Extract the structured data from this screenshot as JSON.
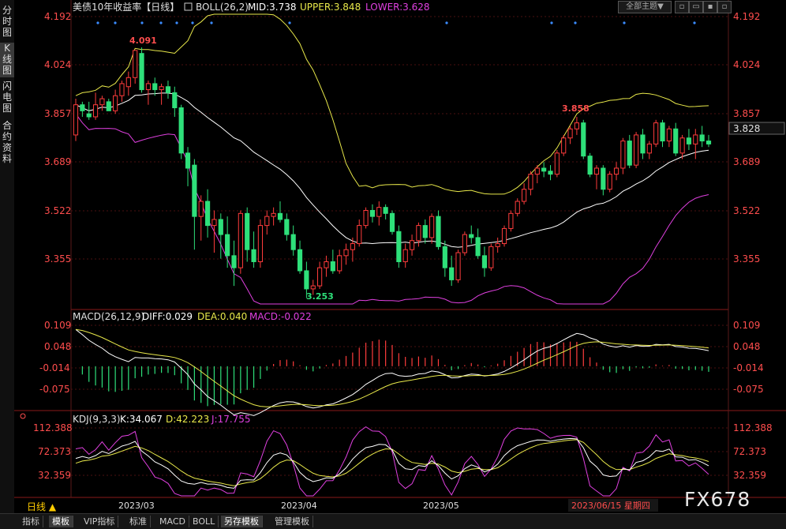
{
  "side_tabs": [
    "分时图",
    "K线图",
    "闪电图",
    "合约资料"
  ],
  "top_controls": {
    "theme": "全部主题▼"
  },
  "main_panel": {
    "title": "美债10年收益率【日线】",
    "boll_label": "BOLL(26,2)",
    "mid": "MID:3.738",
    "upper": "UPPER:3.848",
    "lower": "LOWER:3.628",
    "y_labels": [
      "4.192",
      "4.024",
      "3.857",
      "3.689",
      "3.522",
      "3.355"
    ],
    "current_price": "3.828",
    "high_mark": "4.091",
    "low_mark": "3.253",
    "recent_high_mark": "3.858"
  },
  "macd_panel": {
    "label": "MACD(26,12,9)",
    "diff": "DIFF:0.029",
    "dea": "DEA:0.040",
    "macd": "MACD:-0.022",
    "y_labels": [
      "0.109",
      "0.048",
      "-0.014",
      "-0.075"
    ]
  },
  "kdj_panel": {
    "label": "KDJ(9,3,3)",
    "k": "K:34.067",
    "d": "D:42.223",
    "j": "J:17.755",
    "y_labels": [
      "112.388",
      "72.373",
      "32.359"
    ]
  },
  "xaxis": {
    "period_label": "日线 ▲",
    "dates": [
      "2023/03",
      "2023/04",
      "2023/05"
    ],
    "cursor_date": "2023/06/15 星期四"
  },
  "bottom_tabs": [
    "指标",
    "模板",
    "VIP指标",
    "标准",
    "MACD",
    "BOLL",
    "另存模板",
    "管理模板"
  ],
  "brand": "FX678",
  "colors": {
    "up": "#ff3c3c",
    "down": "#2ee07a",
    "upper": "#e8e84a",
    "mid": "#ffffff",
    "lower": "#e040e0",
    "text": "#ff4d4d"
  },
  "chart_data": {
    "type": "candlestick",
    "title": "美债10年收益率【日线】",
    "ylim": [
      3.24,
      4.2
    ],
    "candles": [
      [
        3.8,
        3.92,
        3.78,
        3.9
      ],
      [
        3.9,
        3.91,
        3.86,
        3.88
      ],
      [
        3.87,
        3.91,
        3.85,
        3.86
      ],
      [
        3.86,
        3.94,
        3.85,
        3.9
      ],
      [
        3.9,
        3.93,
        3.88,
        3.92
      ],
      [
        3.91,
        3.92,
        3.88,
        3.88
      ],
      [
        3.88,
        3.95,
        3.87,
        3.93
      ],
      [
        3.93,
        3.98,
        3.91,
        3.97
      ],
      [
        3.96,
        4.01,
        3.93,
        3.99
      ],
      [
        3.99,
        4.08,
        3.97,
        4.08
      ],
      [
        4.07,
        4.09,
        3.94,
        3.95
      ],
      [
        3.95,
        3.98,
        3.9,
        3.97
      ],
      [
        3.97,
        3.99,
        3.93,
        3.95
      ],
      [
        3.95,
        3.97,
        3.9,
        3.96
      ],
      [
        3.96,
        3.98,
        3.92,
        3.94
      ],
      [
        3.94,
        3.96,
        3.86,
        3.89
      ],
      [
        3.89,
        3.9,
        3.72,
        3.74
      ],
      [
        3.74,
        3.76,
        3.63,
        3.69
      ],
      [
        3.7,
        3.72,
        3.42,
        3.53
      ],
      [
        3.53,
        3.6,
        3.45,
        3.58
      ],
      [
        3.58,
        3.62,
        3.46,
        3.5
      ],
      [
        3.5,
        3.55,
        3.41,
        3.52
      ],
      [
        3.52,
        3.54,
        3.39,
        3.47
      ],
      [
        3.47,
        3.53,
        3.36,
        3.4
      ],
      [
        3.4,
        3.45,
        3.3,
        3.36
      ],
      [
        3.36,
        3.55,
        3.34,
        3.54
      ],
      [
        3.54,
        3.56,
        3.38,
        3.42
      ],
      [
        3.42,
        3.48,
        3.36,
        3.38
      ],
      [
        3.38,
        3.52,
        3.36,
        3.5
      ],
      [
        3.5,
        3.55,
        3.47,
        3.53
      ],
      [
        3.53,
        3.56,
        3.5,
        3.54
      ],
      [
        3.54,
        3.58,
        3.51,
        3.52
      ],
      [
        3.52,
        3.54,
        3.45,
        3.47
      ],
      [
        3.47,
        3.5,
        3.4,
        3.42
      ],
      [
        3.42,
        3.45,
        3.34,
        3.35
      ],
      [
        3.35,
        3.38,
        3.26,
        3.29
      ],
      [
        3.29,
        3.32,
        3.27,
        3.3
      ],
      [
        3.3,
        3.38,
        3.29,
        3.36
      ],
      [
        3.36,
        3.4,
        3.33,
        3.38
      ],
      [
        3.38,
        3.42,
        3.34,
        3.35
      ],
      [
        3.35,
        3.42,
        3.34,
        3.4
      ],
      [
        3.4,
        3.44,
        3.37,
        3.42
      ],
      [
        3.42,
        3.46,
        3.38,
        3.44
      ],
      [
        3.44,
        3.52,
        3.43,
        3.5
      ],
      [
        3.5,
        3.56,
        3.49,
        3.55
      ],
      [
        3.55,
        3.57,
        3.51,
        3.53
      ],
      [
        3.53,
        3.58,
        3.5,
        3.56
      ],
      [
        3.56,
        3.57,
        3.52,
        3.54
      ],
      [
        3.54,
        3.55,
        3.47,
        3.48
      ],
      [
        3.48,
        3.5,
        3.36,
        3.38
      ],
      [
        3.38,
        3.44,
        3.36,
        3.42
      ],
      [
        3.42,
        3.47,
        3.4,
        3.45
      ],
      [
        3.45,
        3.51,
        3.43,
        3.5
      ],
      [
        3.5,
        3.52,
        3.44,
        3.46
      ],
      [
        3.46,
        3.54,
        3.44,
        3.53
      ],
      [
        3.53,
        3.55,
        3.42,
        3.43
      ],
      [
        3.43,
        3.45,
        3.33,
        3.36
      ],
      [
        3.36,
        3.4,
        3.3,
        3.32
      ],
      [
        3.32,
        3.42,
        3.31,
        3.41
      ],
      [
        3.41,
        3.48,
        3.4,
        3.47
      ],
      [
        3.47,
        3.5,
        3.44,
        3.46
      ],
      [
        3.46,
        3.49,
        3.39,
        3.4
      ],
      [
        3.4,
        3.43,
        3.33,
        3.36
      ],
      [
        3.36,
        3.44,
        3.35,
        3.43
      ],
      [
        3.43,
        3.46,
        3.41,
        3.44
      ],
      [
        3.44,
        3.5,
        3.43,
        3.49
      ],
      [
        3.49,
        3.55,
        3.48,
        3.54
      ],
      [
        3.54,
        3.59,
        3.53,
        3.58
      ],
      [
        3.58,
        3.64,
        3.57,
        3.62
      ],
      [
        3.62,
        3.68,
        3.6,
        3.67
      ],
      [
        3.67,
        3.7,
        3.64,
        3.69
      ],
      [
        3.69,
        3.71,
        3.66,
        3.68
      ],
      [
        3.68,
        3.7,
        3.65,
        3.67
      ],
      [
        3.67,
        3.75,
        3.66,
        3.74
      ],
      [
        3.74,
        3.8,
        3.73,
        3.79
      ],
      [
        3.79,
        3.83,
        3.77,
        3.82
      ],
      [
        3.82,
        3.86,
        3.8,
        3.84
      ],
      [
        3.84,
        3.85,
        3.72,
        3.73
      ],
      [
        3.73,
        3.74,
        3.66,
        3.67
      ],
      [
        3.67,
        3.7,
        3.62,
        3.69
      ],
      [
        3.69,
        3.7,
        3.6,
        3.62
      ],
      [
        3.62,
        3.68,
        3.61,
        3.67
      ],
      [
        3.67,
        3.71,
        3.65,
        3.69
      ],
      [
        3.69,
        3.79,
        3.67,
        3.78
      ],
      [
        3.78,
        3.8,
        3.69,
        3.7
      ],
      [
        3.7,
        3.81,
        3.69,
        3.8
      ],
      [
        3.8,
        3.82,
        3.72,
        3.74
      ],
      [
        3.74,
        3.78,
        3.72,
        3.77
      ],
      [
        3.77,
        3.85,
        3.76,
        3.84
      ],
      [
        3.84,
        3.85,
        3.76,
        3.78
      ],
      [
        3.78,
        3.83,
        3.76,
        3.82
      ],
      [
        3.82,
        3.84,
        3.73,
        3.74
      ],
      [
        3.74,
        3.8,
        3.72,
        3.79
      ],
      [
        3.79,
        3.82,
        3.75,
        3.77
      ],
      [
        3.77,
        3.82,
        3.72,
        3.8
      ],
      [
        3.8,
        3.83,
        3.76,
        3.78
      ],
      [
        3.78,
        3.8,
        3.76,
        3.77
      ]
    ],
    "macd": {
      "diff": [
        0.105,
        0.1,
        0.098,
        0.097,
        0.096
      ],
      "dea": [
        0.09,
        0.092,
        0.093,
        0.094,
        0.095
      ]
    }
  }
}
